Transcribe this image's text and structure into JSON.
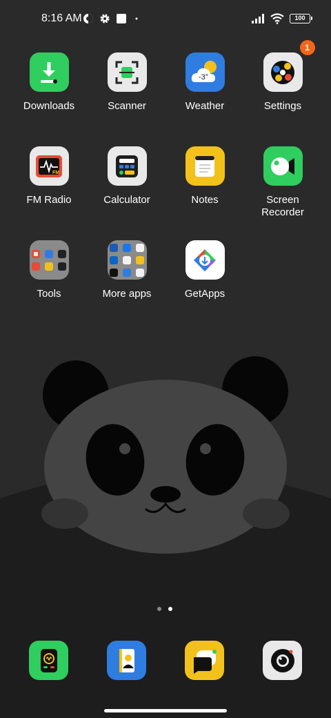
{
  "status_bar": {
    "time": "8:16 AM",
    "battery": "100",
    "left_icons": [
      "data-saver-icon",
      "settings-gear-icon",
      "square-notification-icon",
      "dot-icon"
    ],
    "right_icons": [
      "signal-icon",
      "wifi-icon",
      "battery-icon"
    ]
  },
  "apps": [
    {
      "label": "Downloads",
      "icon": "download-icon",
      "color": "#2fce5f"
    },
    {
      "label": "Scanner",
      "icon": "scanner-icon",
      "color": "#e9e9e9"
    },
    {
      "label": "Weather",
      "icon": "weather-icon",
      "color": "#2f7de1",
      "temp": "-3°"
    },
    {
      "label": "Settings",
      "icon": "settings-icon",
      "color": "#e9e9e9",
      "badge": "1"
    },
    {
      "label": "FM Radio",
      "icon": "radio-icon",
      "color": "#e9e9e9",
      "sub": "FM"
    },
    {
      "label": "Calculator",
      "icon": "calculator-icon",
      "color": "#e9e9e9"
    },
    {
      "label": "Notes",
      "icon": "notes-icon",
      "color": "#f3c11b"
    },
    {
      "label": "Screen\nRecorder",
      "icon": "screen-recorder-icon",
      "color": "#2fce5f"
    },
    {
      "label": "Tools",
      "icon": "tools-folder-icon",
      "color": "#8a8a8a"
    },
    {
      "label": "More apps",
      "icon": "more-apps-folder-icon",
      "color": "#8a8a8a"
    },
    {
      "label": "GetApps",
      "icon": "getapps-icon",
      "color": "#ffffff"
    }
  ],
  "dock": [
    {
      "icon": "phone-icon",
      "color": "#2fce5f"
    },
    {
      "icon": "contacts-icon",
      "color": "#2f7de1"
    },
    {
      "icon": "messaging-icon",
      "color": "#f3c11b"
    },
    {
      "icon": "camera-icon",
      "color": "#e9e9e9"
    }
  ],
  "pages": {
    "count": 2,
    "active": 2
  }
}
